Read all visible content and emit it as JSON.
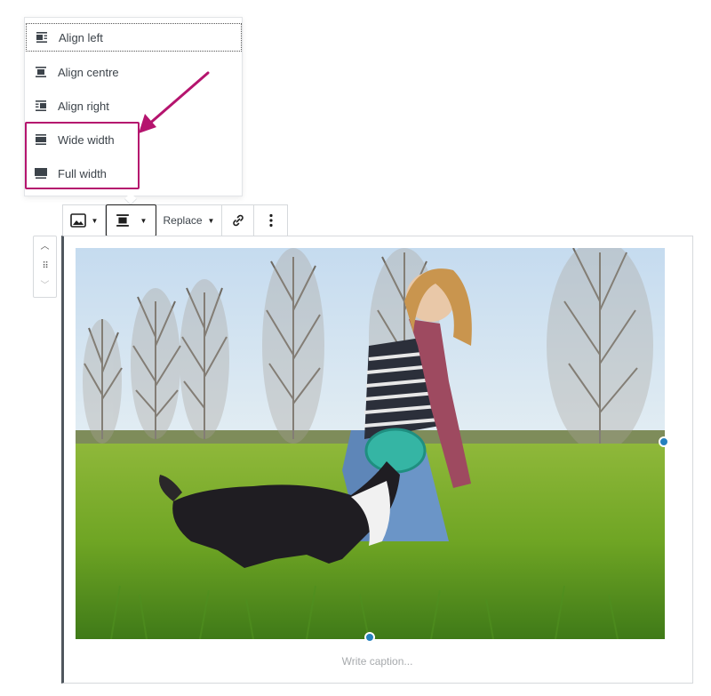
{
  "alignment_menu": {
    "items": [
      {
        "label": "Align left",
        "icon": "align-left-icon"
      },
      {
        "label": "Align centre",
        "icon": "align-center-icon"
      },
      {
        "label": "Align right",
        "icon": "align-right-icon"
      },
      {
        "label": "Wide width",
        "icon": "wide-width-icon"
      },
      {
        "label": "Full width",
        "icon": "full-width-icon"
      }
    ]
  },
  "toolbar": {
    "replace_label": "Replace"
  },
  "image_block": {
    "caption_placeholder": "Write caption..."
  },
  "colors": {
    "highlight": "#b5146e",
    "handle": "#2581be"
  }
}
